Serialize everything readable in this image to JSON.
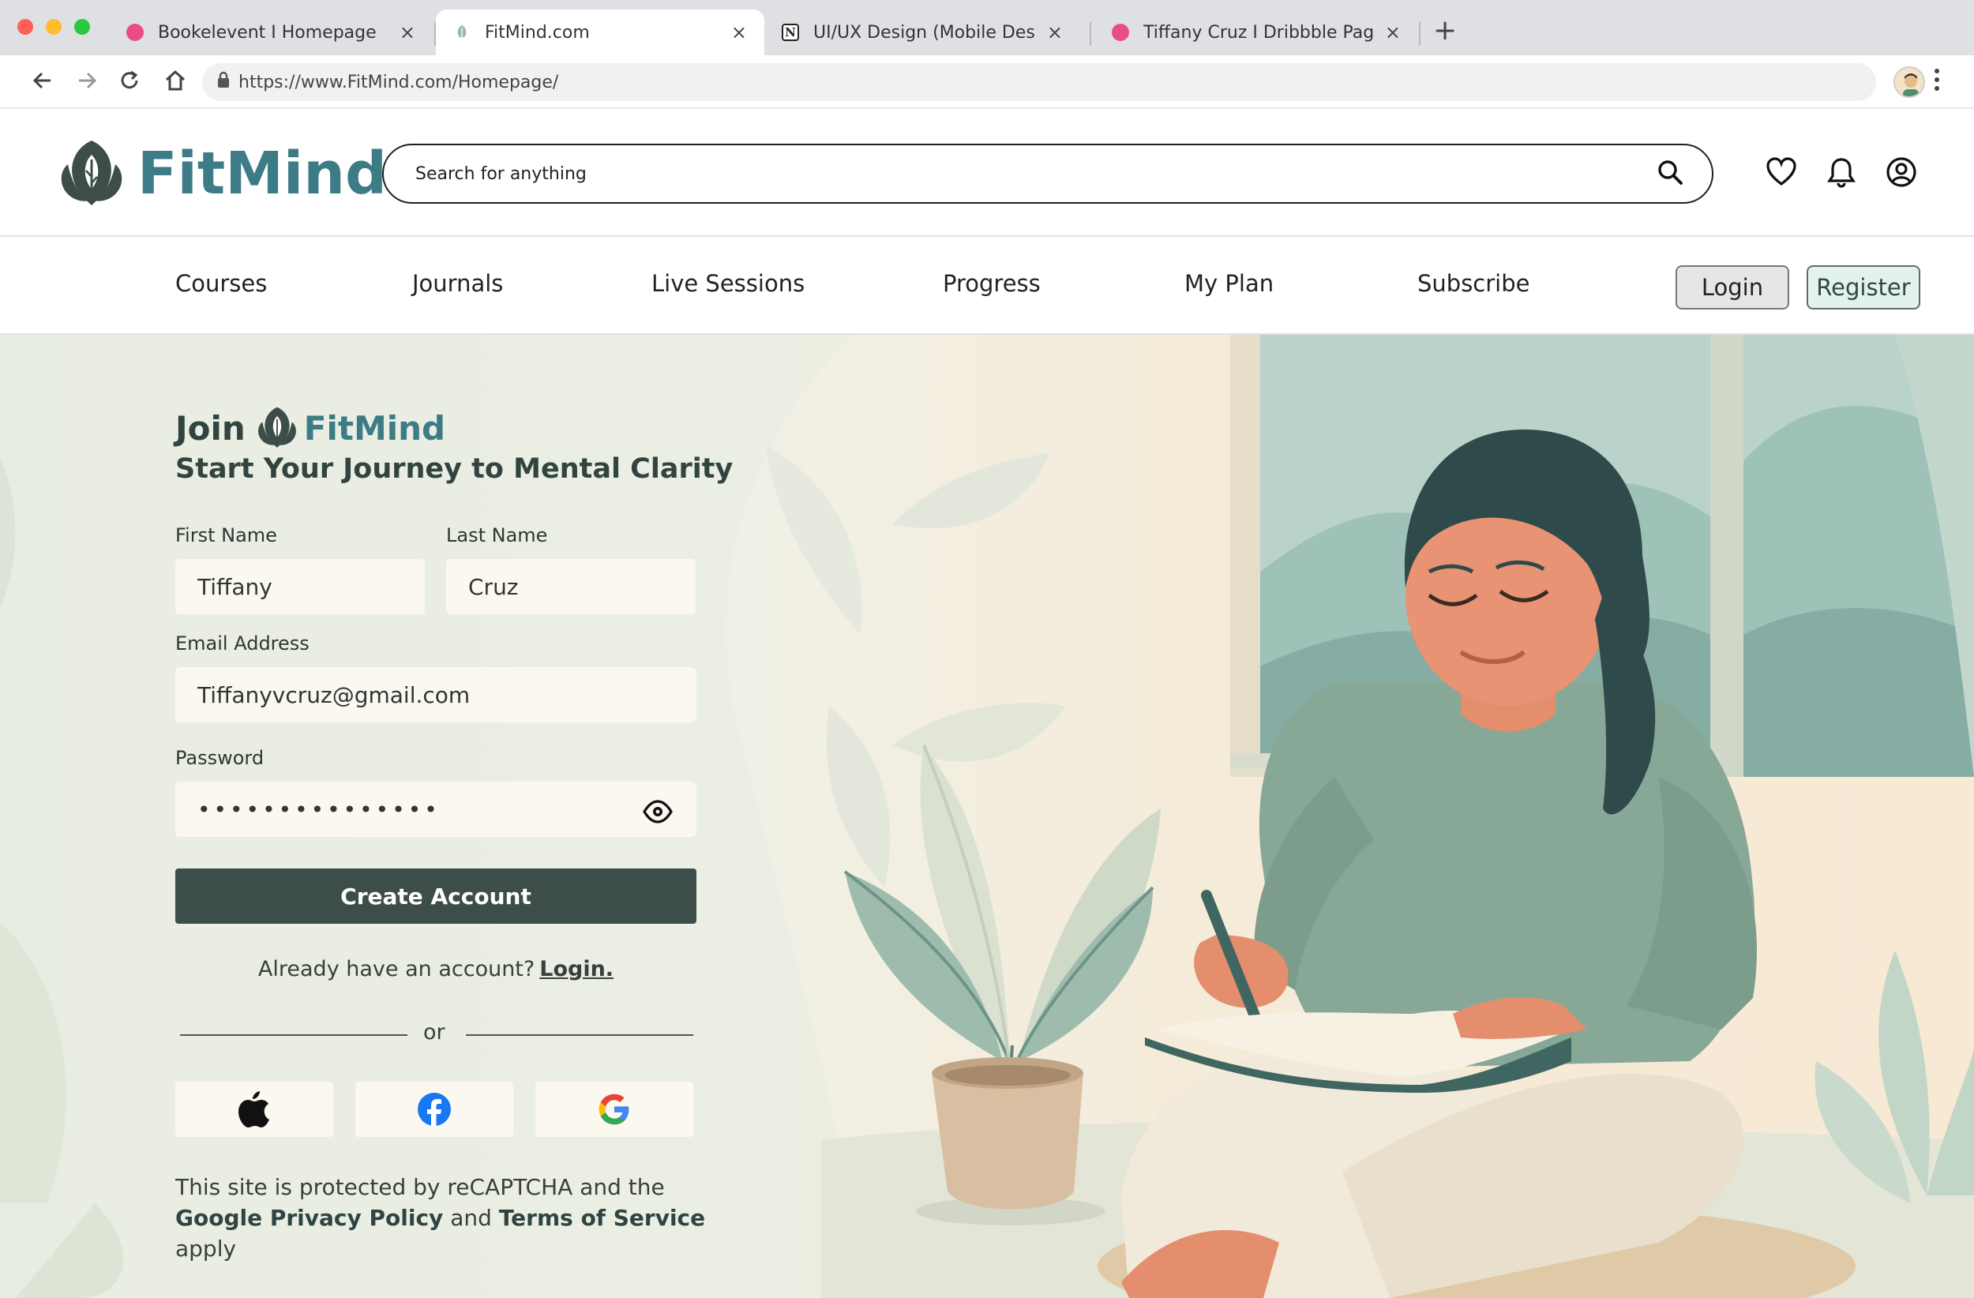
{
  "browser": {
    "tabs": [
      {
        "title": "Bookelevent I Homepage",
        "favicon": "dribbble-icon",
        "active": false
      },
      {
        "title": "FitMind.com",
        "favicon": "fitmind-leaf-icon",
        "active": true
      },
      {
        "title": "UI/UX Design (Mobile Design",
        "favicon": "notion-icon",
        "active": false
      },
      {
        "title": "Tiffany Cruz I Dribbble Page",
        "favicon": "dribbble-icon",
        "active": false
      }
    ],
    "close_glyph": "×",
    "new_tab_glyph": "+",
    "notion_glyph": "N",
    "url": "https://www.FitMind.com/Homepage/"
  },
  "header": {
    "brand": "FitMind",
    "search_placeholder": "Search for anything"
  },
  "nav": {
    "items": [
      "Courses",
      "Journals",
      "Live Sessions",
      "Progress",
      "My Plan",
      "Subscribe"
    ],
    "login_label": "Login",
    "register_label": "Register"
  },
  "form": {
    "join_word": "Join",
    "brand": "FitMind",
    "subtitle": "Start Your Journey to Mental Clarity",
    "first_name_label": "First Name",
    "first_name_value": "Tiffany",
    "last_name_label": "Last Name",
    "last_name_value": "Cruz",
    "email_label": "Email Address",
    "email_value": "Tiffanyvcruz@gmail.com",
    "password_label": "Password",
    "password_value": "•••••••••••••••",
    "create_label": "Create Account",
    "already_text": "Already have an account?",
    "login_link": "Login.",
    "or_text": "or",
    "social": [
      "apple-icon",
      "facebook-icon",
      "google-icon"
    ],
    "legal_pre": "This site is protected by reCAPTCHA and the ",
    "legal_privacy": "Google Privacy Policy",
    "legal_mid": " and ",
    "legal_terms": "Terms of Service",
    "legal_post": " apply"
  },
  "colors": {
    "brand_teal": "#3d7b86",
    "dark_green": "#3c4d4a",
    "register_bg": "#e3f2ea",
    "field_bg": "#fbf8f0"
  }
}
